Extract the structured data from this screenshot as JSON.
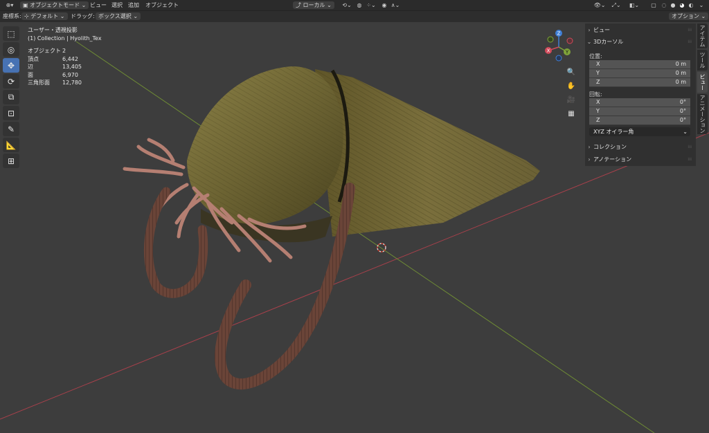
{
  "header": {
    "mode_label": "オブジェクトモード",
    "menus": [
      "ビュー",
      "選択",
      "追加",
      "オブジェクト"
    ],
    "transform_orientation": "ローカル"
  },
  "subheader": {
    "orientation_label": "座標系:",
    "orientation_value": "デフォルト",
    "drag_label": "ドラッグ:",
    "drag_value": "ボックス選択",
    "options_label": "オプション"
  },
  "viewport": {
    "view_name": "ユーザー・透視投影",
    "collection": "(1) Collection | Hyolith_Tex",
    "stats": [
      {
        "label": "オブジェクト",
        "value": "2"
      },
      {
        "label": "頂点",
        "value": "6,442"
      },
      {
        "label": "辺",
        "value": "13,405"
      },
      {
        "label": "面",
        "value": "6,970"
      },
      {
        "label": "三角形面",
        "value": "12,780"
      }
    ]
  },
  "gizmo": {
    "z": "Z",
    "y": "Y",
    "x": "X"
  },
  "npanel": {
    "view_header": "ビュー",
    "cursor_header": "3Dカーソル",
    "location_label": "位置:",
    "location": [
      {
        "axis": "X",
        "value": "0 m"
      },
      {
        "axis": "Y",
        "value": "0 m"
      },
      {
        "axis": "Z",
        "value": "0 m"
      }
    ],
    "rotation_label": "回転:",
    "rotation": [
      {
        "axis": "X",
        "value": "0°"
      },
      {
        "axis": "Y",
        "value": "0°"
      },
      {
        "axis": "Z",
        "value": "0°"
      }
    ],
    "rotation_mode": "XYZ オイラー角",
    "collection_header": "コレクション",
    "annotation_header": "アノテーション"
  },
  "sidetabs": [
    "アイテム",
    "ツール",
    "ビュー",
    "アニメーション"
  ],
  "colors": {
    "x_axis": "#d14a5a",
    "y_axis": "#7fa33a",
    "z_axis": "#3f7fd6",
    "active_tool": "#4772b3"
  }
}
